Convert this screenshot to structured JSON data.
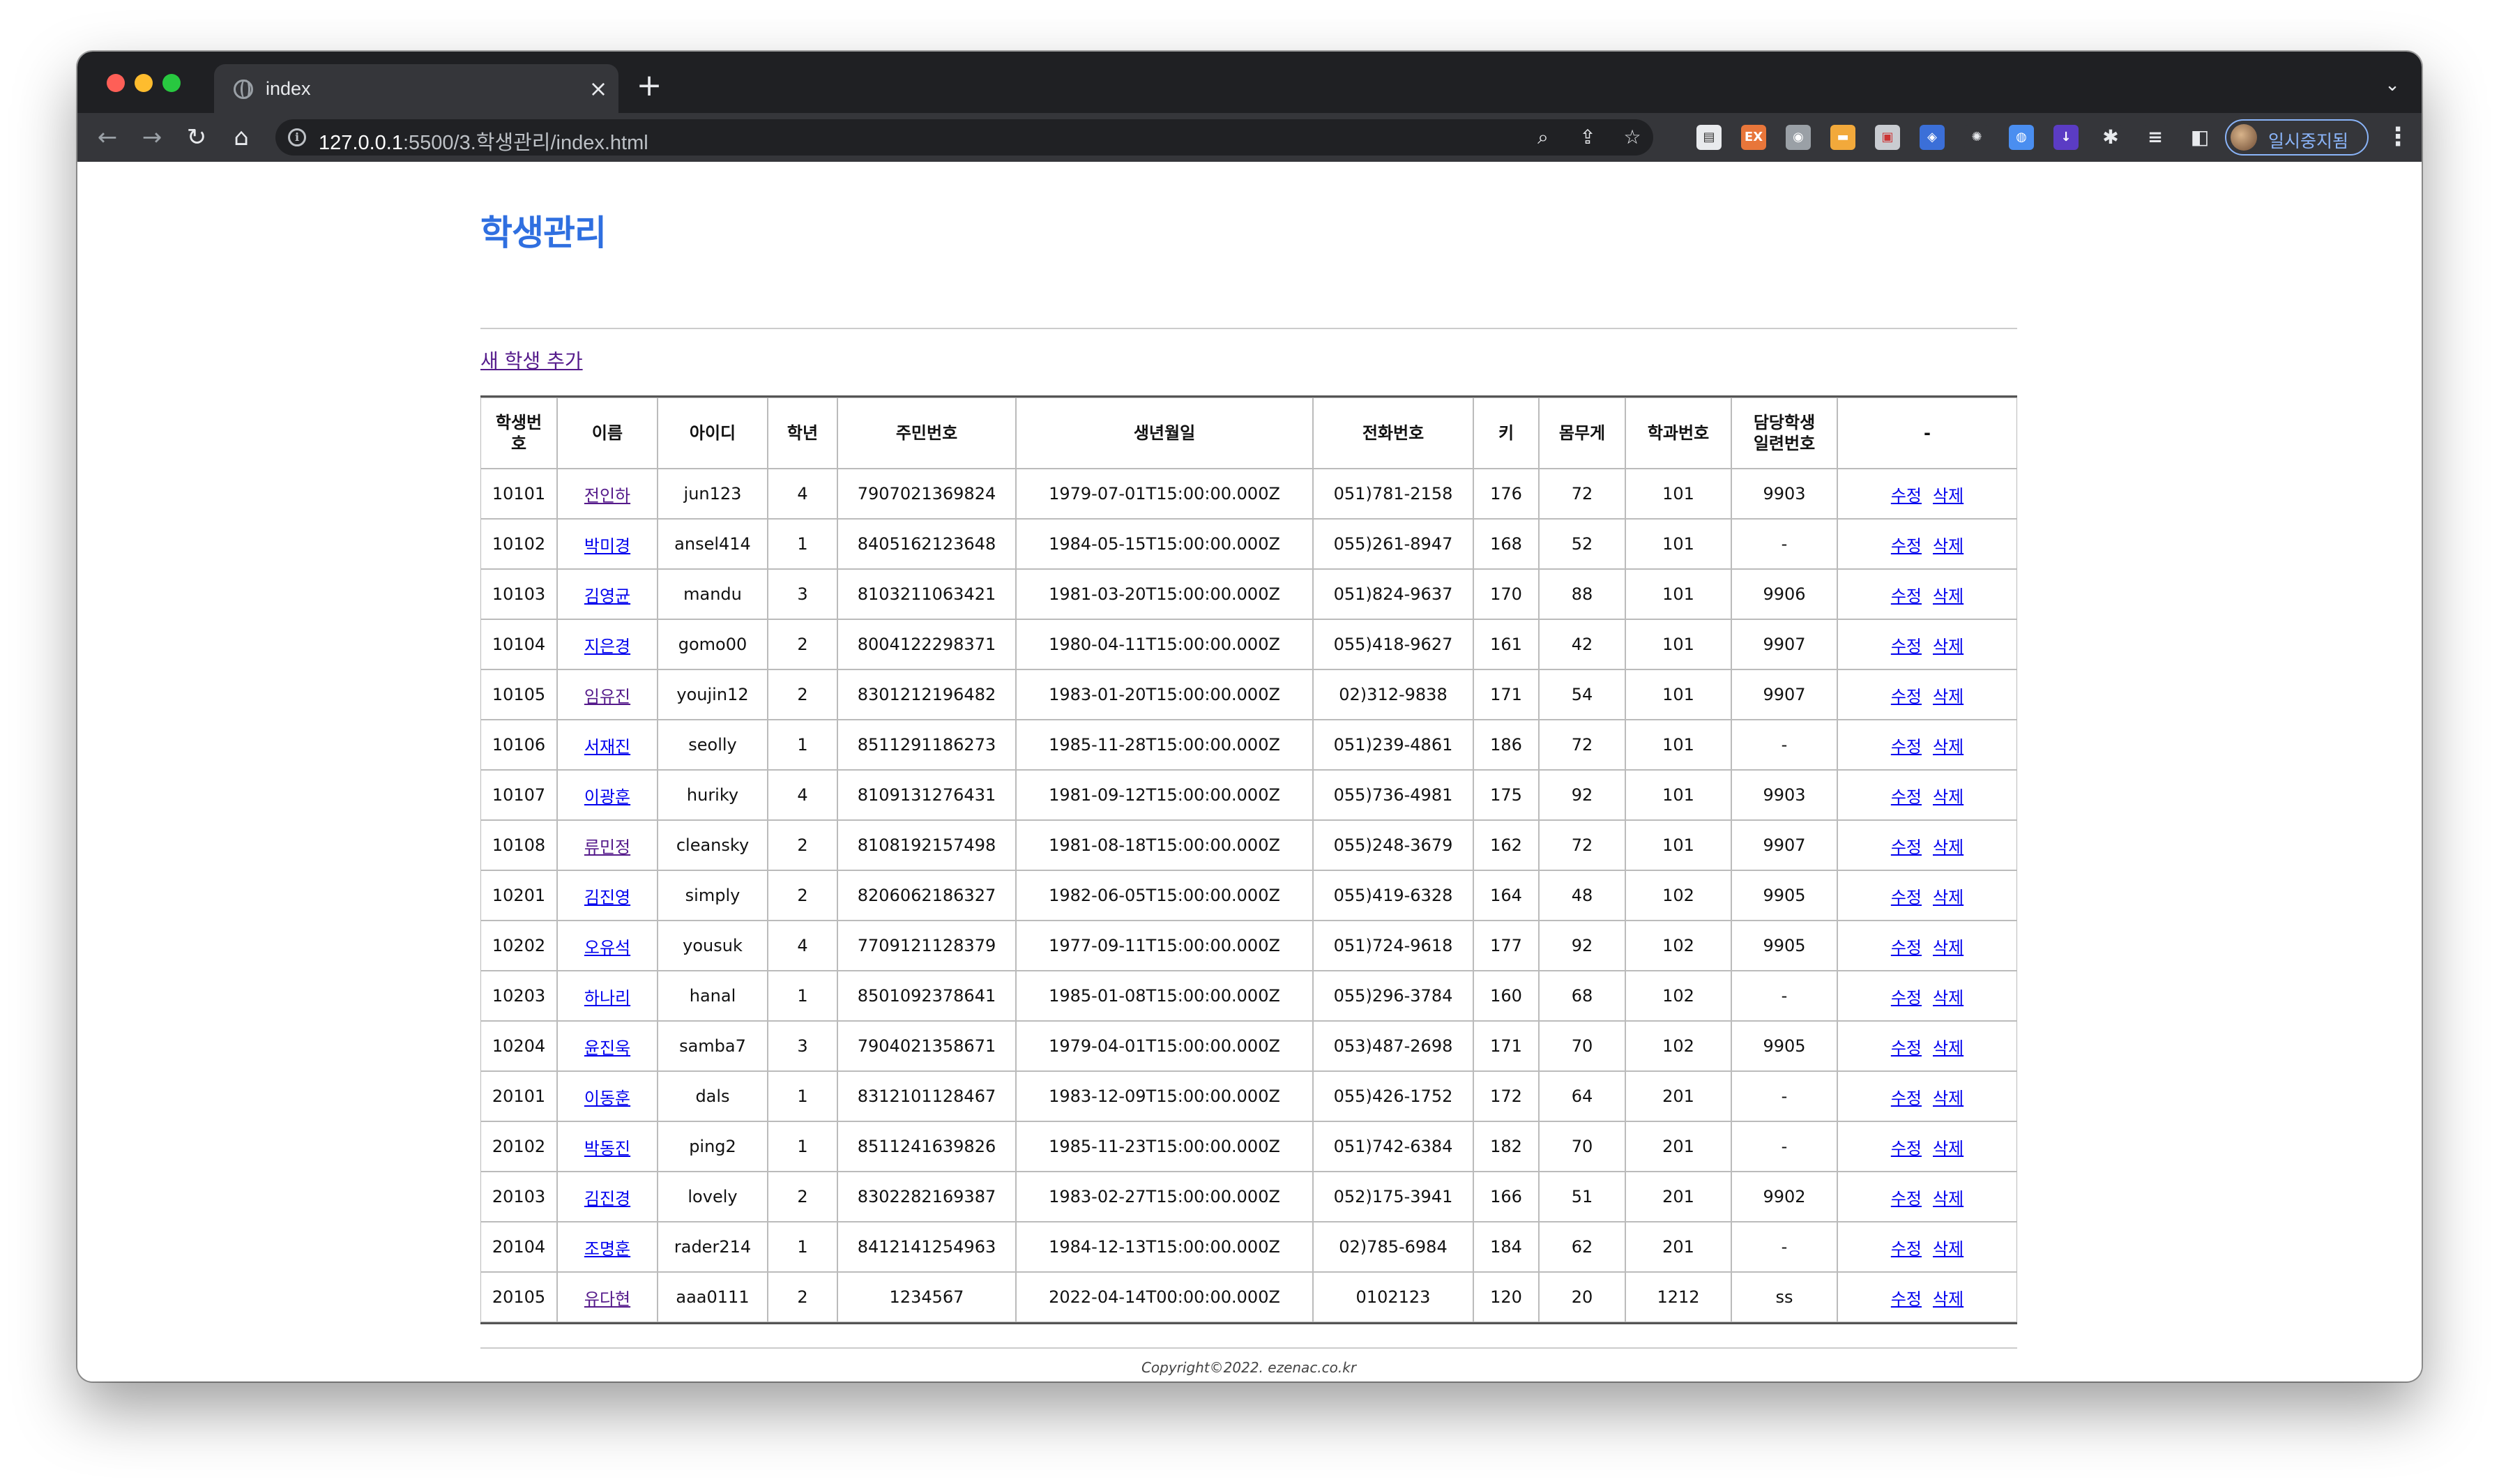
{
  "browser": {
    "tab_title": "index",
    "url_host": "127.0.0.1",
    "url_path": ":5500/3.학생관리/index.html",
    "profile_label": "일시중지됨",
    "icons": [
      "back-arrow-icon",
      "forward-arrow-icon",
      "reload-icon",
      "home-icon",
      "zoom-icon",
      "share-icon",
      "star-icon",
      "puzzle-icon",
      "media-icon",
      "sidepanel-icon",
      "menu-icon"
    ]
  },
  "page": {
    "title": "학생관리",
    "add_link": "새 학생 추가",
    "copyright": "Copyright©2022. ezenac.co.kr"
  },
  "table": {
    "headers": [
      "학생번\n호",
      "이름",
      "아이디",
      "학년",
      "주민번호",
      "생년월일",
      "전화번호",
      "키",
      "몸무게",
      "학과번호",
      "담당학생\n일련번호",
      "-"
    ],
    "edit_label": "수정",
    "delete_label": "삭제",
    "rows": [
      [
        "10101",
        "전인하",
        "jun123",
        "4",
        "7907021369824",
        "1979-07-01T15:00:00.000Z",
        "051)781-2158",
        "176",
        "72",
        "101",
        "9903"
      ],
      [
        "10102",
        "박미경",
        "ansel414",
        "1",
        "8405162123648",
        "1984-05-15T15:00:00.000Z",
        "055)261-8947",
        "168",
        "52",
        "101",
        "-"
      ],
      [
        "10103",
        "김영균",
        "mandu",
        "3",
        "8103211063421",
        "1981-03-20T15:00:00.000Z",
        "051)824-9637",
        "170",
        "88",
        "101",
        "9906"
      ],
      [
        "10104",
        "지은경",
        "gomo00",
        "2",
        "8004122298371",
        "1980-04-11T15:00:00.000Z",
        "055)418-9627",
        "161",
        "42",
        "101",
        "9907"
      ],
      [
        "10105",
        "임유진",
        "youjin12",
        "2",
        "8301212196482",
        "1983-01-20T15:00:00.000Z",
        "02)312-9838",
        "171",
        "54",
        "101",
        "9907"
      ],
      [
        "10106",
        "서재진",
        "seolly",
        "1",
        "8511291186273",
        "1985-11-28T15:00:00.000Z",
        "051)239-4861",
        "186",
        "72",
        "101",
        "-"
      ],
      [
        "10107",
        "이광훈",
        "huriky",
        "4",
        "8109131276431",
        "1981-09-12T15:00:00.000Z",
        "055)736-4981",
        "175",
        "92",
        "101",
        "9903"
      ],
      [
        "10108",
        "류민정",
        "cleansky",
        "2",
        "8108192157498",
        "1981-08-18T15:00:00.000Z",
        "055)248-3679",
        "162",
        "72",
        "101",
        "9907"
      ],
      [
        "10201",
        "김진영",
        "simply",
        "2",
        "8206062186327",
        "1982-06-05T15:00:00.000Z",
        "055)419-6328",
        "164",
        "48",
        "102",
        "9905"
      ],
      [
        "10202",
        "오유석",
        "yousuk",
        "4",
        "7709121128379",
        "1977-09-11T15:00:00.000Z",
        "051)724-9618",
        "177",
        "92",
        "102",
        "9905"
      ],
      [
        "10203",
        "하나리",
        "hanal",
        "1",
        "8501092378641",
        "1985-01-08T15:00:00.000Z",
        "055)296-3784",
        "160",
        "68",
        "102",
        "-"
      ],
      [
        "10204",
        "윤진욱",
        "samba7",
        "3",
        "7904021358671",
        "1979-04-01T15:00:00.000Z",
        "053)487-2698",
        "171",
        "70",
        "102",
        "9905"
      ],
      [
        "20101",
        "이동훈",
        "dals",
        "1",
        "8312101128467",
        "1983-12-09T15:00:00.000Z",
        "055)426-1752",
        "172",
        "64",
        "201",
        "-"
      ],
      [
        "20102",
        "박동진",
        "ping2",
        "1",
        "8511241639826",
        "1985-11-23T15:00:00.000Z",
        "051)742-6384",
        "182",
        "70",
        "201",
        "-"
      ],
      [
        "20103",
        "김진경",
        "lovely",
        "2",
        "8302282169387",
        "1983-02-27T15:00:00.000Z",
        "052)175-3941",
        "166",
        "51",
        "201",
        "9902"
      ],
      [
        "20104",
        "조명훈",
        "rader214",
        "1",
        "8412141254963",
        "1984-12-13T15:00:00.000Z",
        "02)785-6984",
        "184",
        "62",
        "201",
        "-"
      ],
      [
        "20105",
        "유다현",
        "aaa0111",
        "2",
        "1234567",
        "2022-04-14T00:00:00.000Z",
        "0102123",
        "120",
        "20",
        "1212",
        "ss"
      ]
    ],
    "visited_names": [
      "전인하",
      "임유진",
      "류민정",
      "유다현"
    ]
  },
  "colors": {
    "title_blue": "#2f6fe0",
    "link_blue": "#0000ee",
    "visited_purple": "#551a8b",
    "chrome_dark": "#1f2023"
  }
}
